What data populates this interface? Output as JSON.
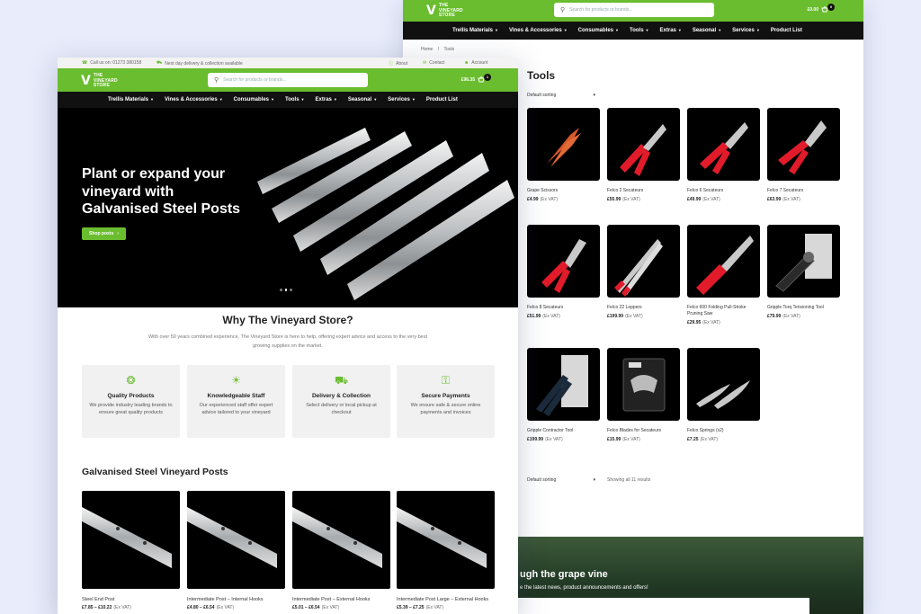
{
  "brand": {
    "line1": "THE",
    "line2": "VINEYARD",
    "line3": "STORE"
  },
  "colors": {
    "accent": "#6abd2e",
    "nav": "#111111",
    "background": "#e8ecfb"
  },
  "search": {
    "placeholder": "Search for products or brands..."
  },
  "nav": [
    "Trellis Materials",
    "Vines & Accessories",
    "Consumables",
    "Tools",
    "Extras",
    "Seasonal",
    "Services",
    "Product List"
  ],
  "nav_dropdown": [
    true,
    true,
    true,
    true,
    true,
    true,
    true,
    false
  ],
  "tools_page": {
    "cart_total": "£0.00",
    "cart_count": "0",
    "breadcrumb": [
      "Home",
      "/",
      "Tools"
    ],
    "title": "Tools",
    "sort_label": "Default sorting",
    "results_text": "Showing all 11 results",
    "products": [
      {
        "name": "Grape Scissors",
        "price": "£4.99",
        "vat": "(Ex VAT)"
      },
      {
        "name": "Felco 2 Secateurs",
        "price": "£55.99",
        "vat": "(Ex VAT)"
      },
      {
        "name": "Felco 6 Secateurs",
        "price": "£49.99",
        "vat": "(Ex VAT)"
      },
      {
        "name": "Felco 7 Secateurs",
        "price": "£63.99",
        "vat": "(Ex VAT)"
      },
      {
        "name": "Felco 8 Secateurs",
        "price": "£51.99",
        "vat": "(Ex VAT)"
      },
      {
        "name": "Felco 22 Loppers",
        "price": "£199.99",
        "vat": "(Ex VAT)"
      },
      {
        "name": "Felco 600 Folding Pull-Stroke Pruning Saw",
        "price": "£29.95",
        "vat": "(Ex VAT)"
      },
      {
        "name": "Gripple Torq Tensioning Tool",
        "price": "£79.99",
        "vat": "(Ex VAT)"
      },
      {
        "name": "Gripple Contractor Tool",
        "price": "£199.99",
        "vat": "(Ex VAT)"
      },
      {
        "name": "Felco Blades for Secateurs",
        "price": "£15.99",
        "vat": "(Ex VAT)"
      },
      {
        "name": "Felco Springs (x2)",
        "price": "£7.25",
        "vat": "(Ex VAT)"
      }
    ],
    "newsletter_heading": "ugh the grape vine",
    "newsletter_sub": "e the latest news, product announcements and offers!"
  },
  "home_page": {
    "util": {
      "phone": "Call us on: 01273 380158",
      "delivery": "Next day delivery & collection available",
      "about": "About",
      "contact": "Contact",
      "account": "Account"
    },
    "cart_total": "£96.35",
    "cart_count": "1",
    "hero": {
      "heading": "Plant or expand your vineyard with Galvanised Steel Posts",
      "button": "Shop posts"
    },
    "why": {
      "heading": "Why The Vineyard Store?",
      "text": "With over 50 years combined experience, The Vineyard Store is here to help, offering expert advice and access to the very best growing supplies on the market.",
      "features": [
        {
          "icon": "award-icon",
          "title": "Quality Products",
          "desc": "We provide industry leading brands  to ensure great quality products"
        },
        {
          "icon": "lightbulb-icon",
          "title": "Knowledgeable Staff",
          "desc": "Our experienced staff offer expert advice tailored to your vineyard"
        },
        {
          "icon": "truck-icon",
          "title": "Delivery & Collection",
          "desc": "Select delivery or local pickup at checkout"
        },
        {
          "icon": "lock-icon",
          "title": "Secure Payments",
          "desc": "We ensure safe & secure online payments and invoices"
        }
      ]
    },
    "posts": {
      "heading": "Galvanised Steel Vineyard Posts",
      "items": [
        {
          "name": "Steel End Post",
          "price": "£7.85 – £10.22",
          "vat": "(Ex VAT)"
        },
        {
          "name": "Intermediate Post – Internal Hooks",
          "price": "£4.80 – £6.54",
          "vat": "(Ex VAT)"
        },
        {
          "name": "Intermediate Post – External Hooks",
          "price": "£5.01 – £6.54",
          "vat": "(Ex VAT)"
        },
        {
          "name": "Intermediate Post Large – External Hooks",
          "price": "£5.39 – £7.25",
          "vat": "(Ex VAT)"
        }
      ]
    }
  }
}
